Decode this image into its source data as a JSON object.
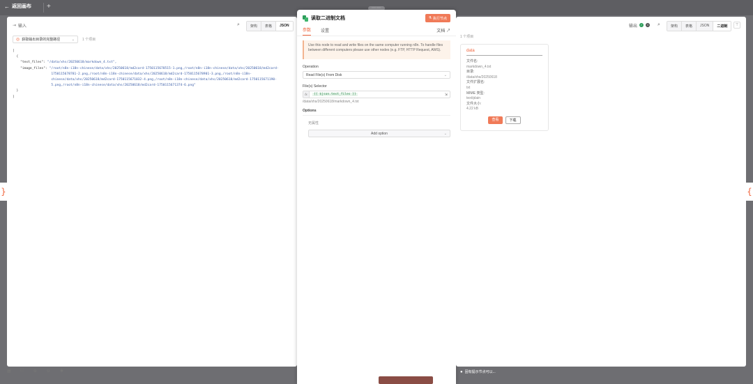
{
  "topbar": {
    "back_label": "返回画布",
    "plus": "+",
    "drag_handle": "⋯⋯"
  },
  "braces": {
    "left": "}",
    "right": "{"
  },
  "input_panel": {
    "title": "输入",
    "view_tabs": [
      "架构",
      "表格",
      "JSON"
    ],
    "active_view": "JSON",
    "filter_select": "获取输出目录的完整路径",
    "item_count": "1 个项目",
    "json_lines": [
      {
        "t": "["
      },
      {
        "t": "  {"
      },
      {
        "k": "    \"text_files\":",
        "v": " \"/data/xhs/20250618/markdown_4.txt\","
      },
      {
        "k": "    \"image_files\":",
        "v": " \"/root/n8n-i18n-chinese/data/xhs/20250618/md2card-1750115678515-1.png,/root/n8n-i18n-chinese/data/xhs/20250618/md2card-"
      },
      {
        "v": "                    1750115678781-2.png,/root/n8n-i18n-chinese/data/xhs/20250618/md2card-1750115678901-3.png,/root/n8n-i18n-"
      },
      {
        "v": "                    chinese/data/xhs/20250618/md2card-1750115671032-4.png,/root/n8n-i18n-chinese/data/xhs/20250618/md2card-1750115671190-"
      },
      {
        "v": "                    5.png,/root/n8n-i18n-chinese/data/xhs/20250618/md2card-1750115671374-6.png\""
      },
      {
        "t": "  }"
      },
      {
        "t": "]"
      }
    ]
  },
  "node_panel": {
    "title": "读取二进制文档",
    "execute_label": "执行节点",
    "tabs": [
      "参数",
      "设置"
    ],
    "active_tab": "参数",
    "docs_label": "文档",
    "notice": "Use this node to read and write files on the same computer running n8n. To handle files between different computers please use other nodes (e.g. FTP, HTTP Request, AWS).",
    "operation_label": "Operation",
    "operation_value": "Read File(s) From Disk",
    "selector_label": "File(s) Selector",
    "selector_fx": "fx",
    "selector_expression": "{{ $json.text_files }}",
    "selector_result": "/data/xhs/20250618/markdown_4.txt",
    "options_label": "Options",
    "no_properties": "无属性",
    "add_option": "Add option"
  },
  "output_panel": {
    "title": "输出",
    "view_tabs": [
      "架构",
      "表格",
      "JSON",
      "二进制"
    ],
    "active_view": "二进制",
    "item_count": "1 个项目",
    "binary_key": "data",
    "meta": [
      {
        "label": "文件名:",
        "value": "markdown_4.txt"
      },
      {
        "label": "目录:",
        "value": "/data/xhs/20250618"
      },
      {
        "label": "文件扩展名:",
        "value": "txt"
      },
      {
        "label": "MIME 类型:",
        "value": "text/plain"
      },
      {
        "label": "文件大小:",
        "value": "4.22 kB"
      }
    ],
    "view_button": "查看",
    "download_button": "下载"
  },
  "bottom": {
    "tip": "固有提示节点可以...",
    "icons": [
      "grid-icon",
      "fit-icon",
      "zoom-in-icon",
      "zoom-out-icon",
      "debug-icon"
    ]
  },
  "colors": {
    "accent": "#f0633b",
    "success": "#2e9e5b",
    "overlay": "#6e6e72"
  }
}
